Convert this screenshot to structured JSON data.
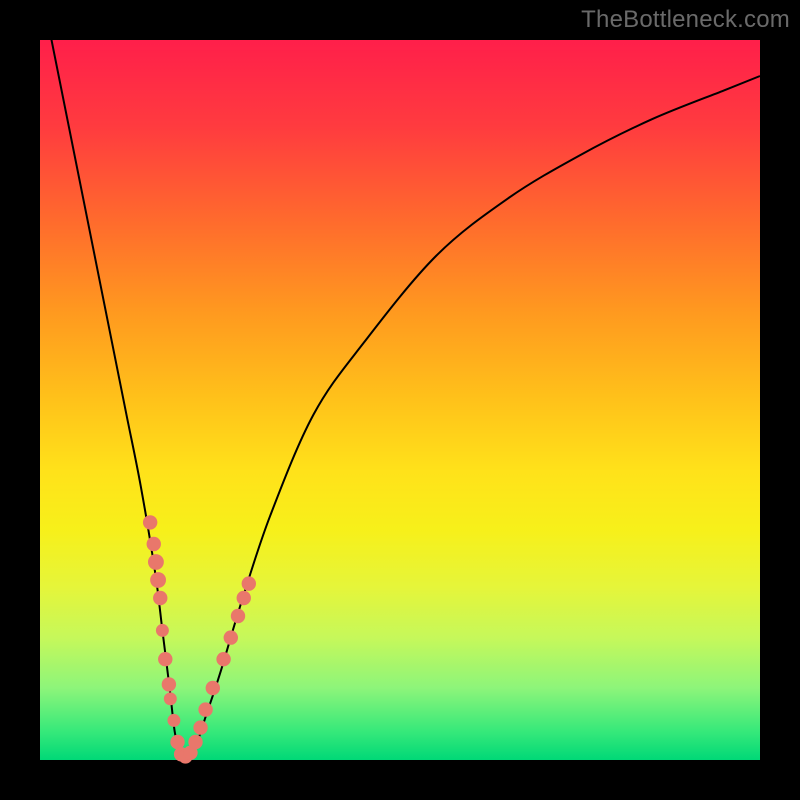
{
  "watermark": "TheBottleneck.com",
  "colors": {
    "frame": "#000000",
    "marker": "#e9776b",
    "curve": "#000000",
    "gradient_top": "#ff1f4a",
    "gradient_bottom": "#00d877"
  },
  "chart_data": {
    "type": "line",
    "title": "",
    "xlabel": "",
    "ylabel": "",
    "xlim": [
      0,
      100
    ],
    "ylim": [
      0,
      100
    ],
    "grid": false,
    "legend": false,
    "series": [
      {
        "name": "bottleneck-curve",
        "x": [
          0,
          2,
          4,
          6,
          8,
          10,
          12,
          14,
          16,
          17,
          18,
          18.7,
          19.3,
          20,
          21,
          22,
          23,
          25,
          28,
          32,
          38,
          45,
          55,
          65,
          75,
          85,
          95,
          100
        ],
        "y": [
          108,
          98,
          88,
          78,
          68,
          58,
          48,
          38,
          26,
          18,
          10,
          4,
          1.5,
          0.5,
          1.5,
          3,
          6,
          12,
          22,
          34,
          48,
          58,
          70,
          78,
          84,
          89,
          93,
          95
        ]
      }
    ],
    "markers": [
      {
        "x": 15.3,
        "y": 33,
        "r": 1.0
      },
      {
        "x": 15.8,
        "y": 30,
        "r": 1.0
      },
      {
        "x": 16.1,
        "y": 27.5,
        "r": 1.1
      },
      {
        "x": 16.4,
        "y": 25,
        "r": 1.1
      },
      {
        "x": 16.7,
        "y": 22.5,
        "r": 1.0
      },
      {
        "x": 17.0,
        "y": 18,
        "r": 0.9
      },
      {
        "x": 17.4,
        "y": 14,
        "r": 1.0
      },
      {
        "x": 17.9,
        "y": 10.5,
        "r": 1.0
      },
      {
        "x": 18.1,
        "y": 8.5,
        "r": 0.9
      },
      {
        "x": 18.6,
        "y": 5.5,
        "r": 0.9
      },
      {
        "x": 19.1,
        "y": 2.5,
        "r": 1.0
      },
      {
        "x": 19.6,
        "y": 0.8,
        "r": 1.0
      },
      {
        "x": 20.2,
        "y": 0.5,
        "r": 1.0
      },
      {
        "x": 20.9,
        "y": 1.0,
        "r": 1.0
      },
      {
        "x": 21.6,
        "y": 2.5,
        "r": 1.0
      },
      {
        "x": 22.3,
        "y": 4.5,
        "r": 1.0
      },
      {
        "x": 23.0,
        "y": 7.0,
        "r": 1.0
      },
      {
        "x": 24.0,
        "y": 10.0,
        "r": 1.0
      },
      {
        "x": 25.5,
        "y": 14.0,
        "r": 1.0
      },
      {
        "x": 26.5,
        "y": 17.0,
        "r": 1.0
      },
      {
        "x": 27.5,
        "y": 20.0,
        "r": 1.0
      },
      {
        "x": 28.3,
        "y": 22.5,
        "r": 1.0
      },
      {
        "x": 29.0,
        "y": 24.5,
        "r": 1.0
      }
    ]
  }
}
